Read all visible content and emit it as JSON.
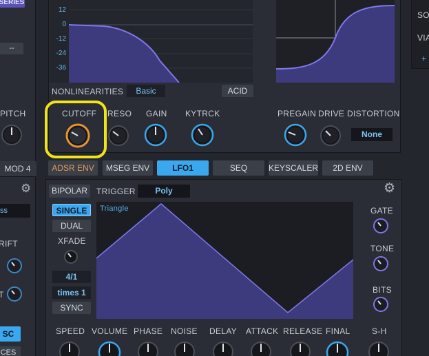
{
  "left_strip": {
    "series_label": "SERIES",
    "dash_value": "--",
    "pitch_label": "PITCH",
    "mod4_tab": "MOD 4",
    "ss_label": "ss",
    "rift_label": "RIFT",
    "t_label": "T",
    "sc_label": "SC",
    "ces_label": "CES"
  },
  "filter": {
    "y_ticks": [
      "12",
      "0",
      "-12",
      "-24",
      "-36"
    ],
    "nonlinearities_label": "NONLINEARITIES",
    "nonlinearities_value": "Basic",
    "acid_button": "ACID",
    "cutoff_label": "CUTOFF",
    "reso_label": "RESO",
    "gain_label": "GAIN",
    "kytrck_label": "KYTRCK",
    "pregain_label": "PREGAIN",
    "drive_label": "DRIVE",
    "distortion_label": "DISTORTION",
    "distortion_value": "None"
  },
  "right_strip": {
    "so_label": "SO",
    "via_label": "VIA",
    "plus_label": "+"
  },
  "mod_tabs": [
    "ADSR ENV",
    "MSEG ENV",
    "LFO1",
    "SEQ",
    "KEYSCALER",
    "2D ENV"
  ],
  "lfo": {
    "bipolar_button": "BIPOLAR",
    "trigger_label": "TRIGGER",
    "trigger_value": "Poly",
    "single_button": "SINGLE",
    "dual_button": "DUAL",
    "xfade_label": "XFADE",
    "rate_value": "4/1",
    "times_value": "times 1",
    "sync_button": "SYNC",
    "shape_name": "Triangle",
    "gate_label": "GATE",
    "tone_label": "TONE",
    "bits_label": "BITS",
    "bottom_labels": [
      "SPEED",
      "VOLUME",
      "PHASE",
      "NOISE",
      "DELAY",
      "ATTACK",
      "RELEASE",
      "FINAL",
      "S-H"
    ]
  },
  "colors": {
    "accent_blue": "#3aa7ee",
    "highlight_yellow": "#f2e21a",
    "knob_orange": "#e8952e",
    "graph_fill": "#3e3a7e",
    "graph_line": "#7f78e8"
  }
}
